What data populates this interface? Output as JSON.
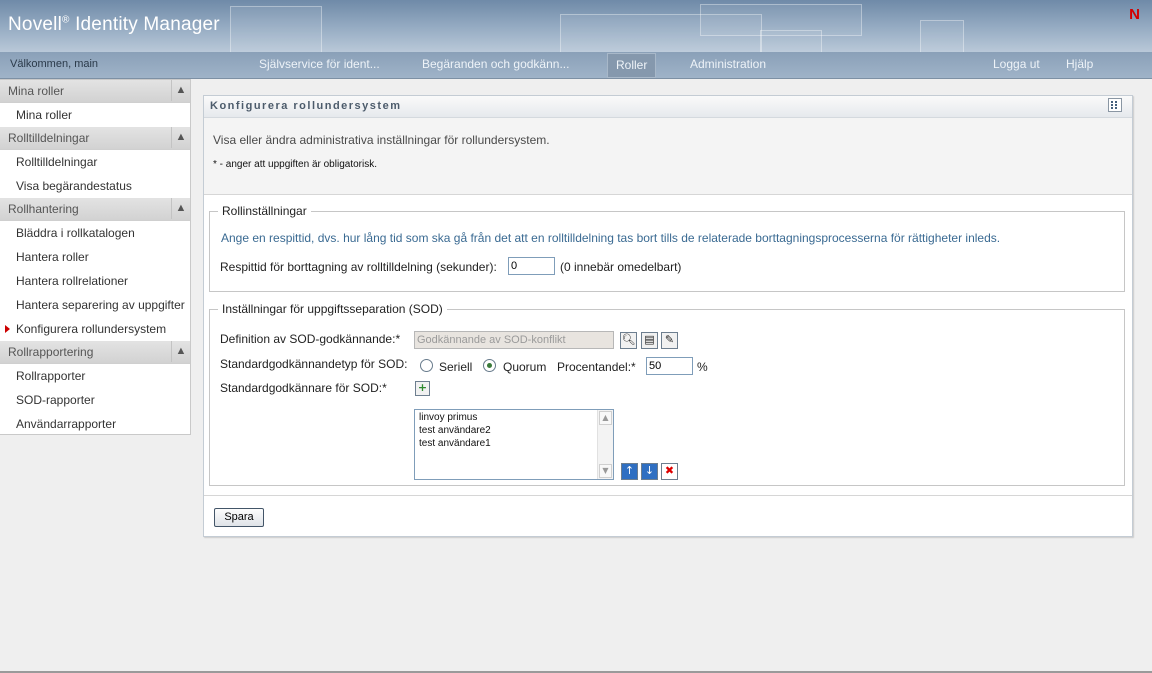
{
  "header": {
    "brand": "Novell",
    "brand_reg": "®",
    "brand_product": "Identity Manager",
    "logo_letter": "N",
    "welcome": "Välkommen, main"
  },
  "nav": {
    "tabs": [
      {
        "label": "Självservice för ident...",
        "active": false
      },
      {
        "label": "Begäranden och godkänn...",
        "active": false
      },
      {
        "label": "Roller",
        "active": true
      },
      {
        "label": "Administration",
        "active": false
      }
    ],
    "logout": "Logga ut",
    "help": "Hjälp"
  },
  "sidebar": {
    "sections": [
      {
        "title": "Mina roller",
        "items": [
          "Mina roller"
        ]
      },
      {
        "title": "Rolltilldelningar",
        "items": [
          "Rolltilldelningar",
          "Visa begärandestatus"
        ]
      },
      {
        "title": "Rollhantering",
        "items": [
          "Bläddra i rollkatalogen",
          "Hantera roller",
          "Hantera rollrelationer",
          "Hantera separering av uppgifter",
          "Konfigurera rollundersystem"
        ]
      },
      {
        "title": "Rollrapportering",
        "items": [
          "Rollrapporter",
          "SOD-rapporter",
          "Användarrapporter"
        ]
      }
    ],
    "active_item": "Konfigurera rollundersystem"
  },
  "panel": {
    "title": "Konfigurera rollundersystem",
    "description": "Visa eller ändra administrativa inställningar för rollundersystem.",
    "required_note": "* - anger att uppgiften är obligatorisk.",
    "role_settings": {
      "legend": "Rollinställningar",
      "info": "Ange en respittid, dvs. hur lång tid som ska gå från det att en rolltilldelning tas bort tills de relaterade borttagningsprocesserna för rättigheter inleds.",
      "grace_label": "Respittid för borttagning av rolltilldelning (sekunder):",
      "grace_value": "0",
      "grace_hint": "(0 innebär omedelbart)"
    },
    "sod_settings": {
      "legend": "Inställningar för uppgiftsseparation (SOD)",
      "definition_label": "Definition av SOD-godkännande:*",
      "definition_value": "Godkännande av SOD-konflikt",
      "type_label": "Standardgodkännandetyp för SOD:",
      "option_serial": "Seriell",
      "option_quorum": "Quorum",
      "selected_option": "Quorum",
      "percent_label": "Procentandel:*",
      "percent_value": "50",
      "percent_sign": "%",
      "approvers_label": "Standardgodkännare för SOD:*",
      "approvers": [
        "linvoy primus",
        "test användare2",
        "test användare1"
      ]
    },
    "save_label": "Spara"
  },
  "colors": {
    "header_blue": "#8aa0b8",
    "accent_link": "#3a6a92",
    "active_marker": "#cc0000",
    "logo_red": "#d40000"
  }
}
